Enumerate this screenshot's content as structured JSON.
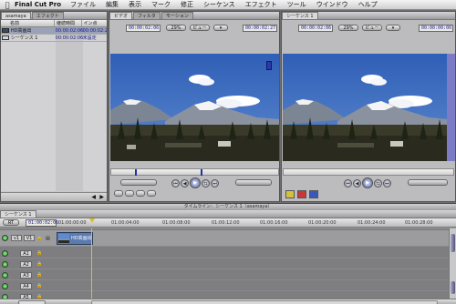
{
  "menubar": {
    "apple": "",
    "app_name": "Final Cut Pro",
    "items": [
      "ファイル",
      "編集",
      "表示",
      "マーク",
      "修正",
      "シーケンス",
      "エフェクト",
      "ツール",
      "ウインドウ",
      "ヘルプ"
    ]
  },
  "browser": {
    "tabs": [
      "asamaya",
      "エフェクト"
    ],
    "columns": [
      "名前",
      "継続時間",
      "イン点"
    ],
    "rows": [
      {
        "name": "HD高画出",
        "duration": "00:00:02:06",
        "in": "00:00:02:2"
      },
      {
        "name": "シーケンス 1",
        "duration": "00:00:02:06",
        "in": "未設定"
      }
    ]
  },
  "viewer": {
    "tabs": [
      "ビデオ",
      "フィルタ",
      "モーション"
    ],
    "timecode_left": "00:00:02:06",
    "timecode_right": "00:00:02:27",
    "zoom": "29%",
    "view": "ビュー"
  },
  "canvas": {
    "tab": "シーケンス 1",
    "timecode_left": "00:00:02:06",
    "timecode_right": "00:00:00:00",
    "zoom": "29%",
    "view": "ビュー"
  },
  "timeline": {
    "title": "タイムライン：シーケンス 1（asamaya）",
    "tab": "シーケンス 1",
    "timecode": "01:00:02:06",
    "render": "RT",
    "ruler": [
      "01:00:00:00",
      "01:00:04:00",
      "01:00:08:00",
      "01:00:12:00",
      "01:00:16:00",
      "01:00:20:00",
      "01:00:24:00",
      "01:00:28:00"
    ],
    "video_track": {
      "src": "v1",
      "dst": "V1",
      "clip": "HD高画出"
    },
    "audio_tracks": [
      {
        "src": "",
        "dst": "A1"
      },
      {
        "src": "",
        "dst": "A2"
      },
      {
        "src": "",
        "dst": "A3"
      },
      {
        "src": "",
        "dst": "A4"
      },
      {
        "src": "",
        "dst": "A5"
      }
    ]
  },
  "colors": {
    "record_green": "#3fb83a",
    "sky": "#3f6dbd",
    "clip": "#5a7ab0"
  }
}
